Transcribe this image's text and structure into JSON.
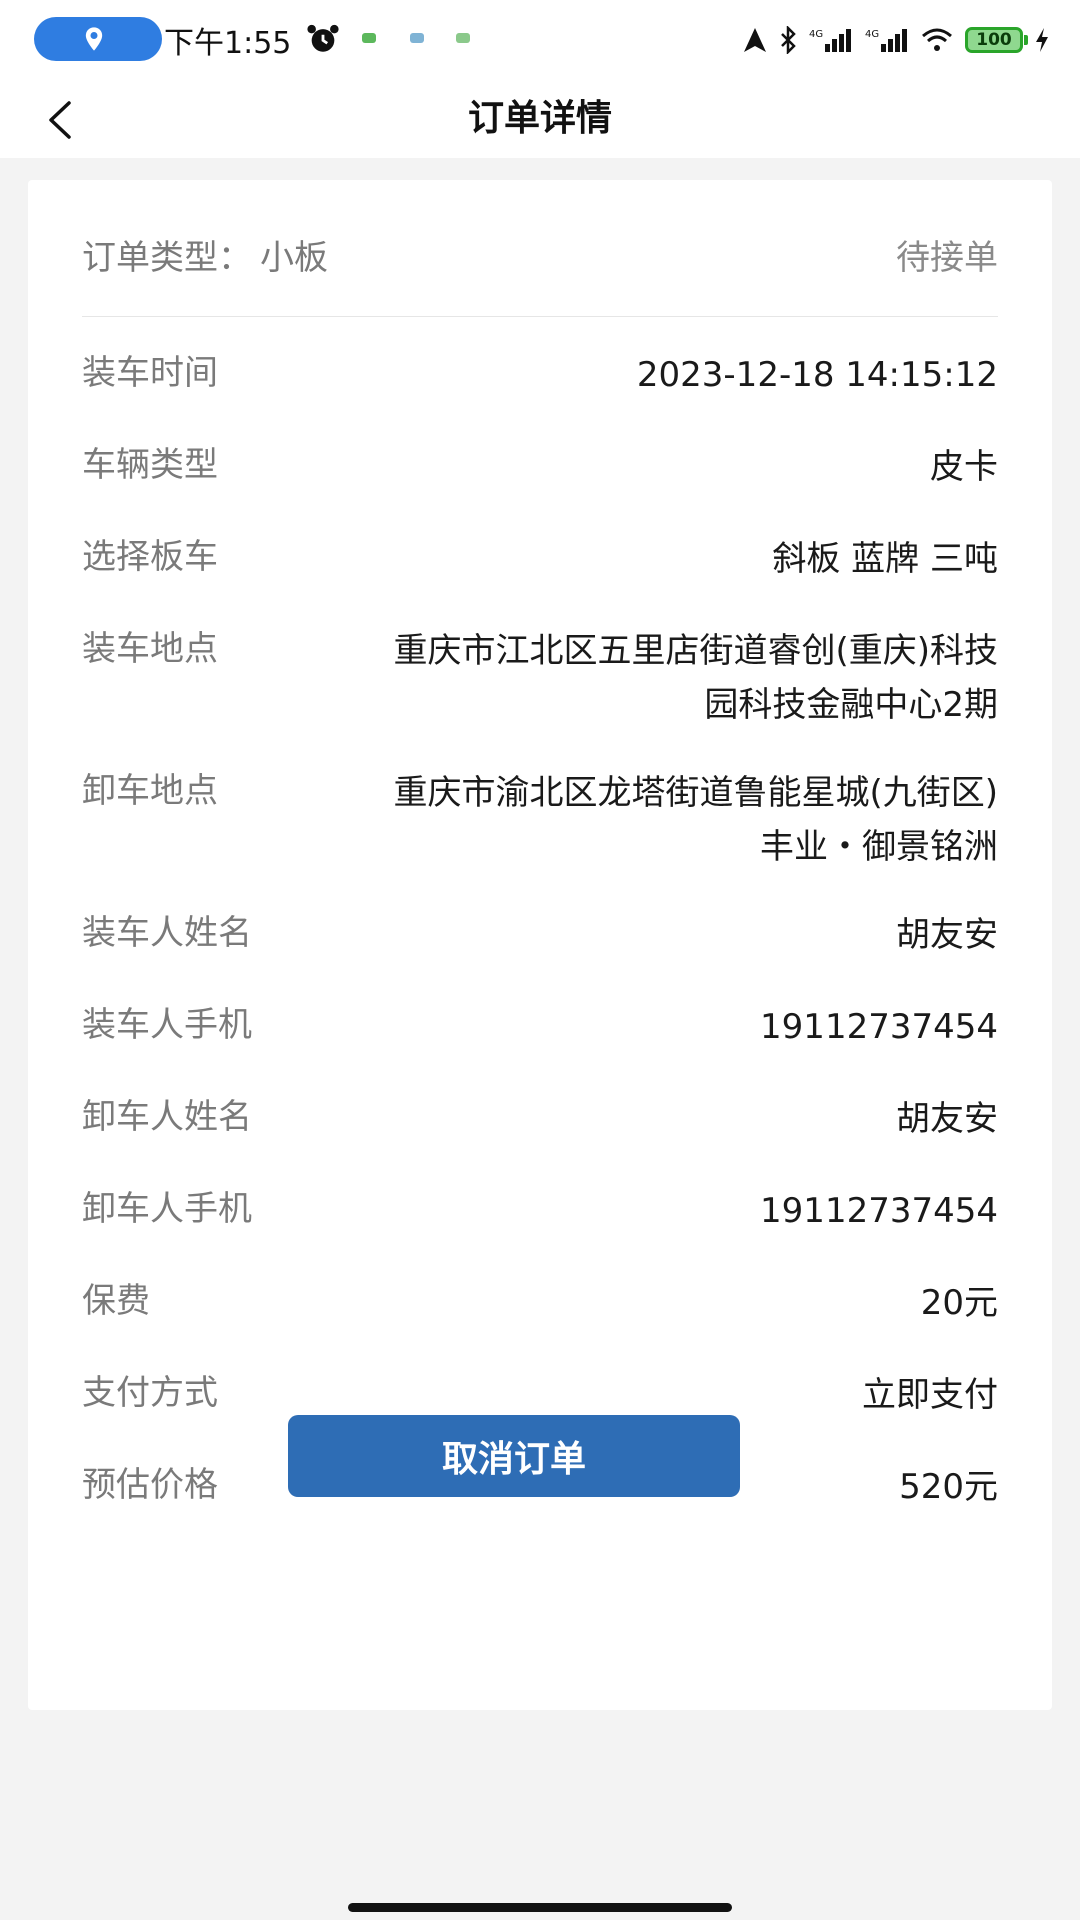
{
  "status_bar": {
    "time": "下午1:55",
    "battery": "100"
  },
  "nav": {
    "title": "订单详情"
  },
  "order": {
    "type_label": "订单类型：",
    "type_value": "小板",
    "status": "待接单"
  },
  "details": [
    {
      "label": "装车时间",
      "value": "2023-12-18 14:15:12"
    },
    {
      "label": "车辆类型",
      "value": "皮卡"
    },
    {
      "label": "选择板车",
      "value": "斜板 蓝牌 三吨"
    },
    {
      "label": "装车地点",
      "value": "重庆市江北区五里店街道睿创(重庆)科技园科技金融中心2期"
    },
    {
      "label": "卸车地点",
      "value": "重庆市渝北区龙塔街道鲁能星城(九街区)丰业・御景铭洲"
    },
    {
      "label": "装车人姓名",
      "value": "胡友安"
    },
    {
      "label": "装车人手机",
      "value": "19112737454"
    },
    {
      "label": "卸车人姓名",
      "value": "胡友安"
    },
    {
      "label": "卸车人手机",
      "value": "19112737454"
    },
    {
      "label": "保费",
      "value": "20元"
    },
    {
      "label": "支付方式",
      "value": "立即支付"
    },
    {
      "label": "预估价格",
      "value": "520元"
    }
  ],
  "actions": {
    "cancel_label": "取消订单"
  },
  "colors": {
    "primary_button": "#2e6db5",
    "status_pill": "#2f7de1",
    "battery": "#8fd88f"
  }
}
